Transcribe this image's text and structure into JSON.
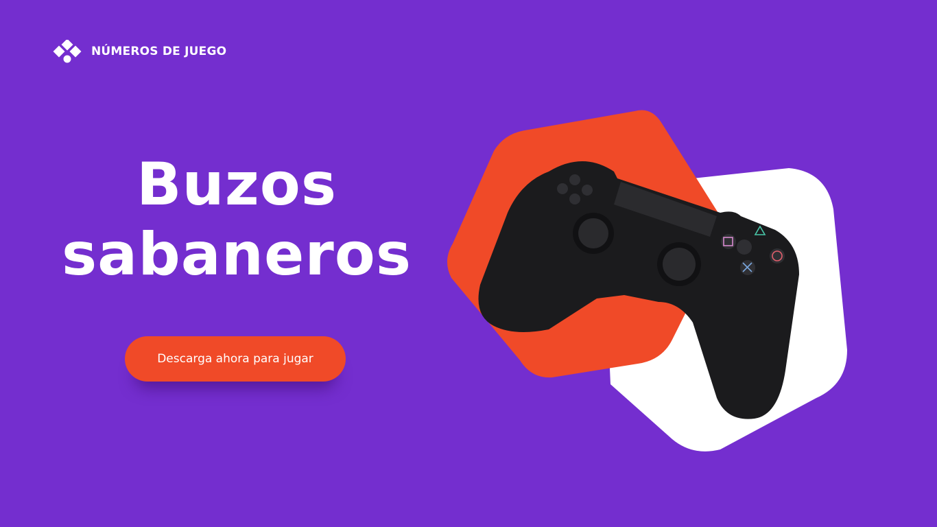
{
  "brand": {
    "name": "NÚMEROS DE JUEGO",
    "logo_icon": "four-diamond-logo-icon"
  },
  "headline": {
    "line1": "Buzos",
    "line2": "sabaneros"
  },
  "cta": {
    "label": "Descarga ahora para jugar"
  },
  "illustration": {
    "subject": "game-controller-icon"
  },
  "colors": {
    "background": "#742ecf",
    "accent": "#f04a28",
    "white": "#ffffff",
    "controller": "#1b1b1d"
  }
}
